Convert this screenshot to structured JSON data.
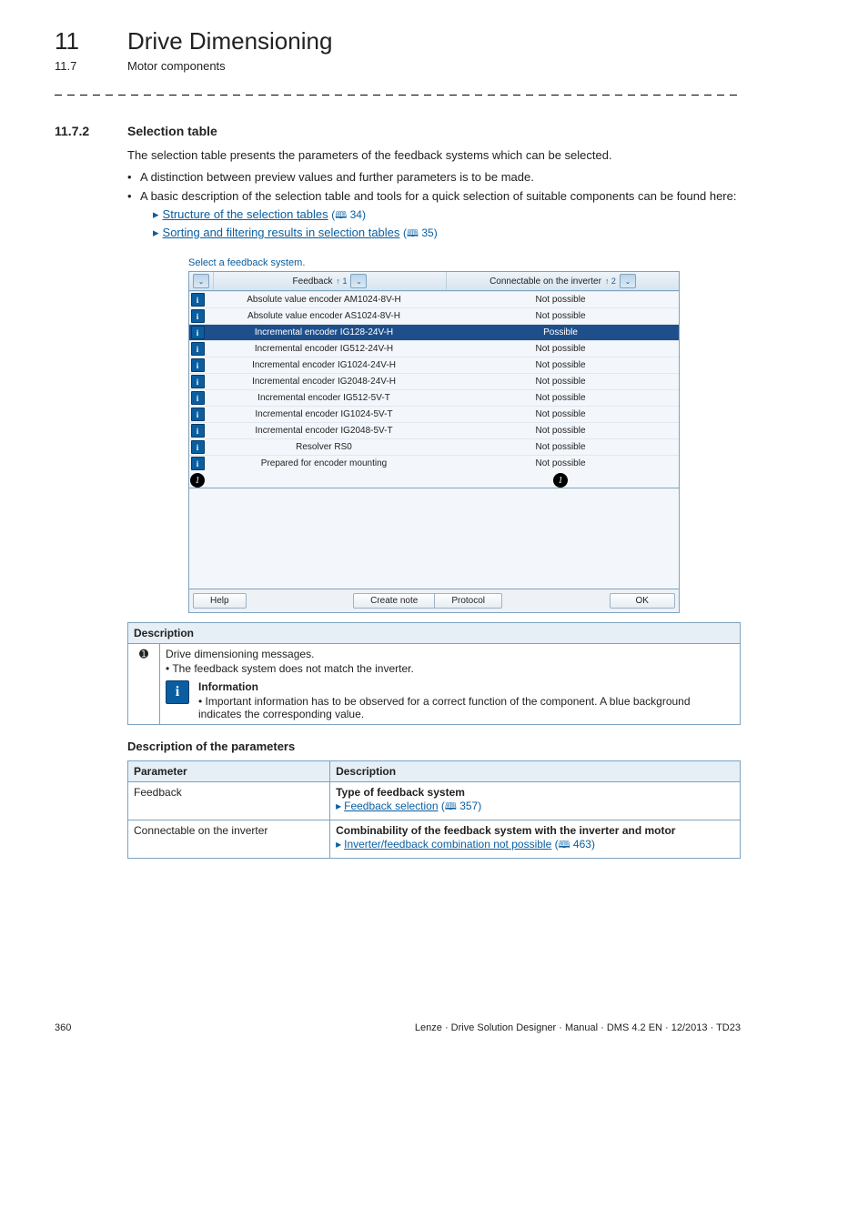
{
  "chapter": {
    "num": "11",
    "title": "Drive Dimensioning"
  },
  "subchapter": {
    "num": "11.7",
    "title": "Motor components"
  },
  "section": {
    "num": "11.7.2",
    "title": "Selection table"
  },
  "intro": "The selection table presents the parameters of the feedback systems which can be selected.",
  "bullets1": "A distinction between preview values and further parameters is to be made.",
  "bullets2": "A basic description of the selection table and tools for a quick selection of suitable components can be found here:",
  "links": {
    "l1": "Structure of the selection tables",
    "l1_ref": "34",
    "l2": "Sorting and filtering results in selection tables",
    "l2_ref": "35"
  },
  "scr": {
    "title": "Select a feedback system.",
    "h1": "Feedback",
    "h2": "Connectable on the inverter",
    "sort1": "↑ 1",
    "sort2": "↑ 2",
    "rows": [
      {
        "c1": "Absolute value encoder AM1024-8V-H",
        "c2": "Not possible",
        "hl": false
      },
      {
        "c1": "Absolute value encoder AS1024-8V-H",
        "c2": "Not possible",
        "hl": false
      },
      {
        "c1": "Incremental encoder IG128-24V-H",
        "c2": "Possible",
        "hl": true
      },
      {
        "c1": "Incremental encoder IG512-24V-H",
        "c2": "Not possible",
        "hl": false
      },
      {
        "c1": "Incremental encoder IG1024-24V-H",
        "c2": "Not possible",
        "hl": false
      },
      {
        "c1": "Incremental encoder IG2048-24V-H",
        "c2": "Not possible",
        "hl": false
      },
      {
        "c1": "Incremental encoder IG512-5V-T",
        "c2": "Not possible",
        "hl": false
      },
      {
        "c1": "Incremental encoder IG1024-5V-T",
        "c2": "Not possible",
        "hl": false
      },
      {
        "c1": "Incremental encoder IG2048-5V-T",
        "c2": "Not possible",
        "hl": false
      },
      {
        "c1": "Resolver RS0",
        "c2": "Not possible",
        "hl": false
      },
      {
        "c1": "Prepared for encoder mounting",
        "c2": "Not possible",
        "hl": false
      }
    ],
    "buttons": {
      "help": "Help",
      "create": "Create note",
      "protocol": "Protocol",
      "ok": "OK"
    }
  },
  "desc": {
    "header": "Description",
    "row1_title": "Drive dimensioning messages.",
    "row1_b1": "The feedback system does not match the inverter.",
    "info_title": "Information",
    "info_b1": "Important information has to be observed for a correct function of the component. A blue background indicates the corresponding value."
  },
  "param": {
    "subhead": "Description of the parameters",
    "h1": "Parameter",
    "h2": "Description",
    "r1c1": "Feedback",
    "r1t": "Type of feedback system",
    "r1link": "Feedback selection",
    "r1ref": "357",
    "r2c1": "Connectable on the inverter",
    "r2t": "Combinability of the feedback system with the inverter and motor",
    "r2link": "Inverter/feedback combination not possible",
    "r2ref": "463"
  },
  "footer": {
    "page": "360",
    "right": "Lenze · Drive Solution Designer · Manual · DMS 4.2 EN · 12/2013 · TD23"
  },
  "glyph": {
    "i": "i",
    "one": "1",
    "book": "🕮",
    "dd": "⌄"
  }
}
